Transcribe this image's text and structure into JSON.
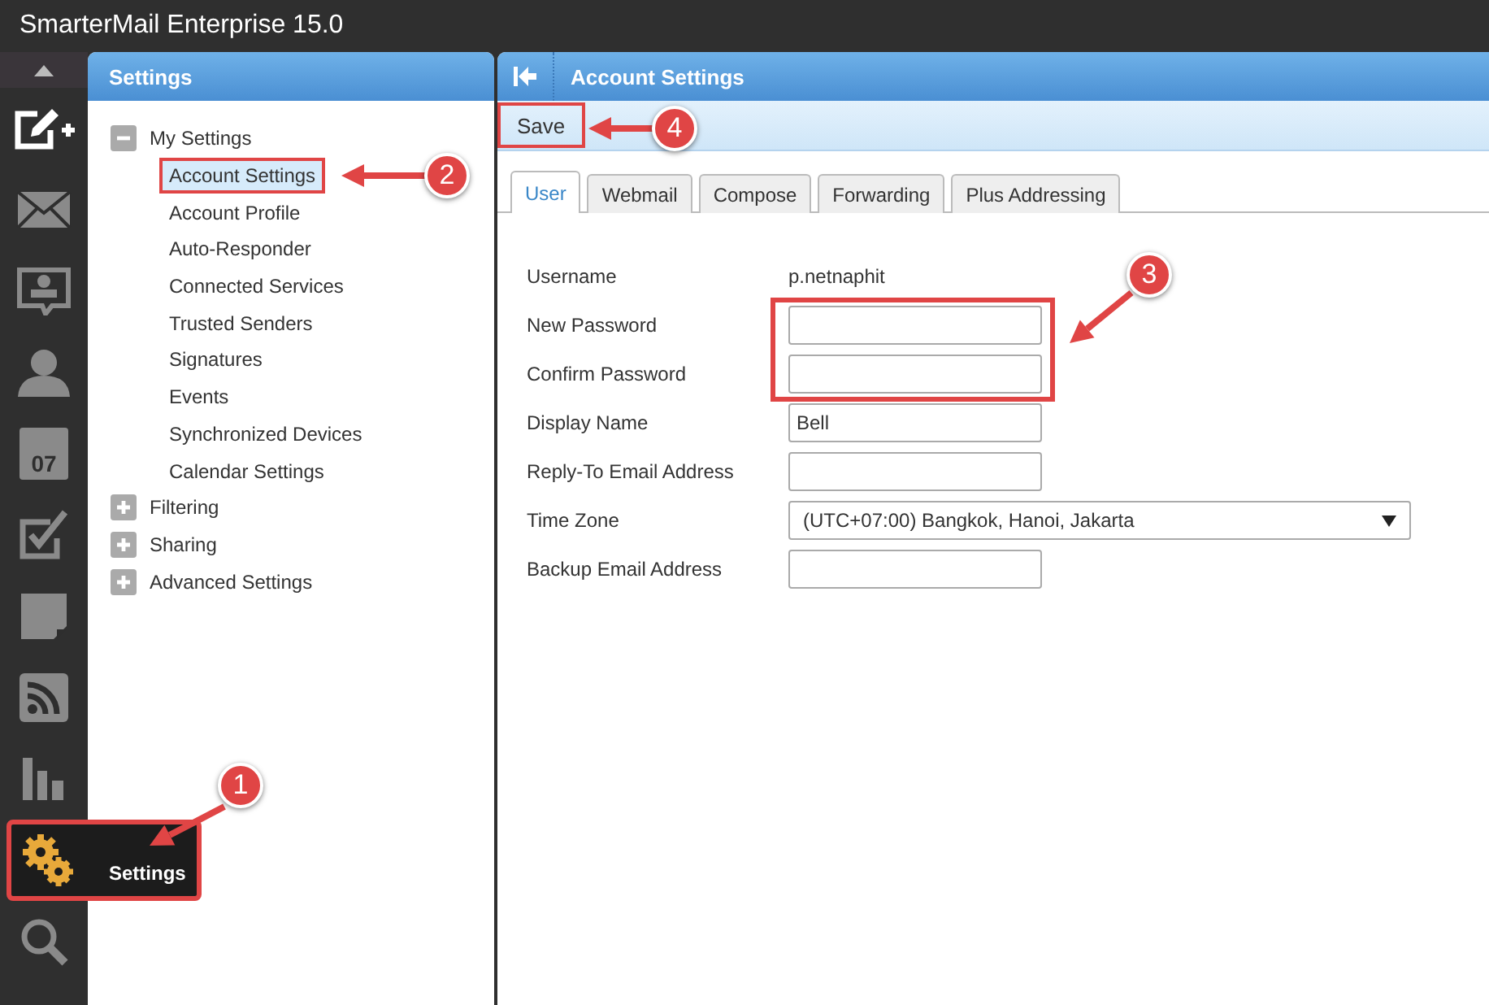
{
  "window": {
    "title": "SmarterMail Enterprise 15.0"
  },
  "rail": {
    "items": [
      {
        "kind": "scroll-up",
        "selected": false
      },
      {
        "kind": "compose",
        "selected": false
      },
      {
        "kind": "mail",
        "selected": false
      },
      {
        "kind": "chat",
        "selected": false
      },
      {
        "kind": "contacts",
        "selected": false
      },
      {
        "kind": "calendar",
        "selected": false,
        "label": "07"
      },
      {
        "kind": "tasks",
        "selected": false
      },
      {
        "kind": "notes",
        "selected": false
      },
      {
        "kind": "rss",
        "selected": false
      },
      {
        "kind": "reports",
        "selected": false
      },
      {
        "kind": "settings",
        "selected": true,
        "highlighted": true,
        "label": "Settings"
      },
      {
        "kind": "search",
        "selected": false
      }
    ]
  },
  "sidebar": {
    "title": "Settings",
    "tree": [
      {
        "label": "My Settings",
        "expanded": true,
        "children": [
          {
            "label": "Account Settings",
            "selected": true,
            "highlighted": true
          },
          {
            "label": "Account Profile",
            "selected": false
          },
          {
            "label": "Auto-Responder",
            "selected": false
          },
          {
            "label": "Connected Services",
            "selected": false
          },
          {
            "label": "Trusted Senders",
            "selected": false
          },
          {
            "label": "Signatures",
            "selected": false
          },
          {
            "label": "Events",
            "selected": false
          },
          {
            "label": "Synchronized Devices",
            "selected": false
          },
          {
            "label": "Calendar Settings",
            "selected": false
          }
        ]
      },
      {
        "label": "Filtering",
        "expanded": false
      },
      {
        "label": "Sharing",
        "expanded": false
      },
      {
        "label": "Advanced Settings",
        "expanded": false
      }
    ]
  },
  "main": {
    "title": "Account Settings",
    "toolbar": [
      {
        "label": "Save",
        "highlighted": true
      }
    ],
    "tabs": [
      {
        "label": "User",
        "selected": true
      },
      {
        "label": "Webmail",
        "selected": false
      },
      {
        "label": "Compose",
        "selected": false
      },
      {
        "label": "Forwarding",
        "selected": false
      },
      {
        "label": "Plus Addressing",
        "selected": false
      }
    ],
    "form": [
      {
        "kind": "text",
        "label": "Username",
        "value": "p.netnaphit"
      },
      {
        "kind": "input",
        "label": "New Password",
        "highlighted": true
      },
      {
        "kind": "input",
        "label": "Confirm Password",
        "highlighted": true
      },
      {
        "kind": "input",
        "label": "Display Name",
        "value": "Bell"
      },
      {
        "kind": "input",
        "label": "Reply-To Email Address"
      },
      {
        "kind": "select",
        "label": "Time Zone",
        "value": "(UTC+07:00) Bangkok, Hanoi, Jakarta"
      },
      {
        "kind": "input",
        "label": "Backup Email Address"
      }
    ]
  },
  "annotations": [
    {
      "number": "1"
    },
    {
      "number": "2"
    },
    {
      "number": "3"
    },
    {
      "number": "4"
    }
  ]
}
